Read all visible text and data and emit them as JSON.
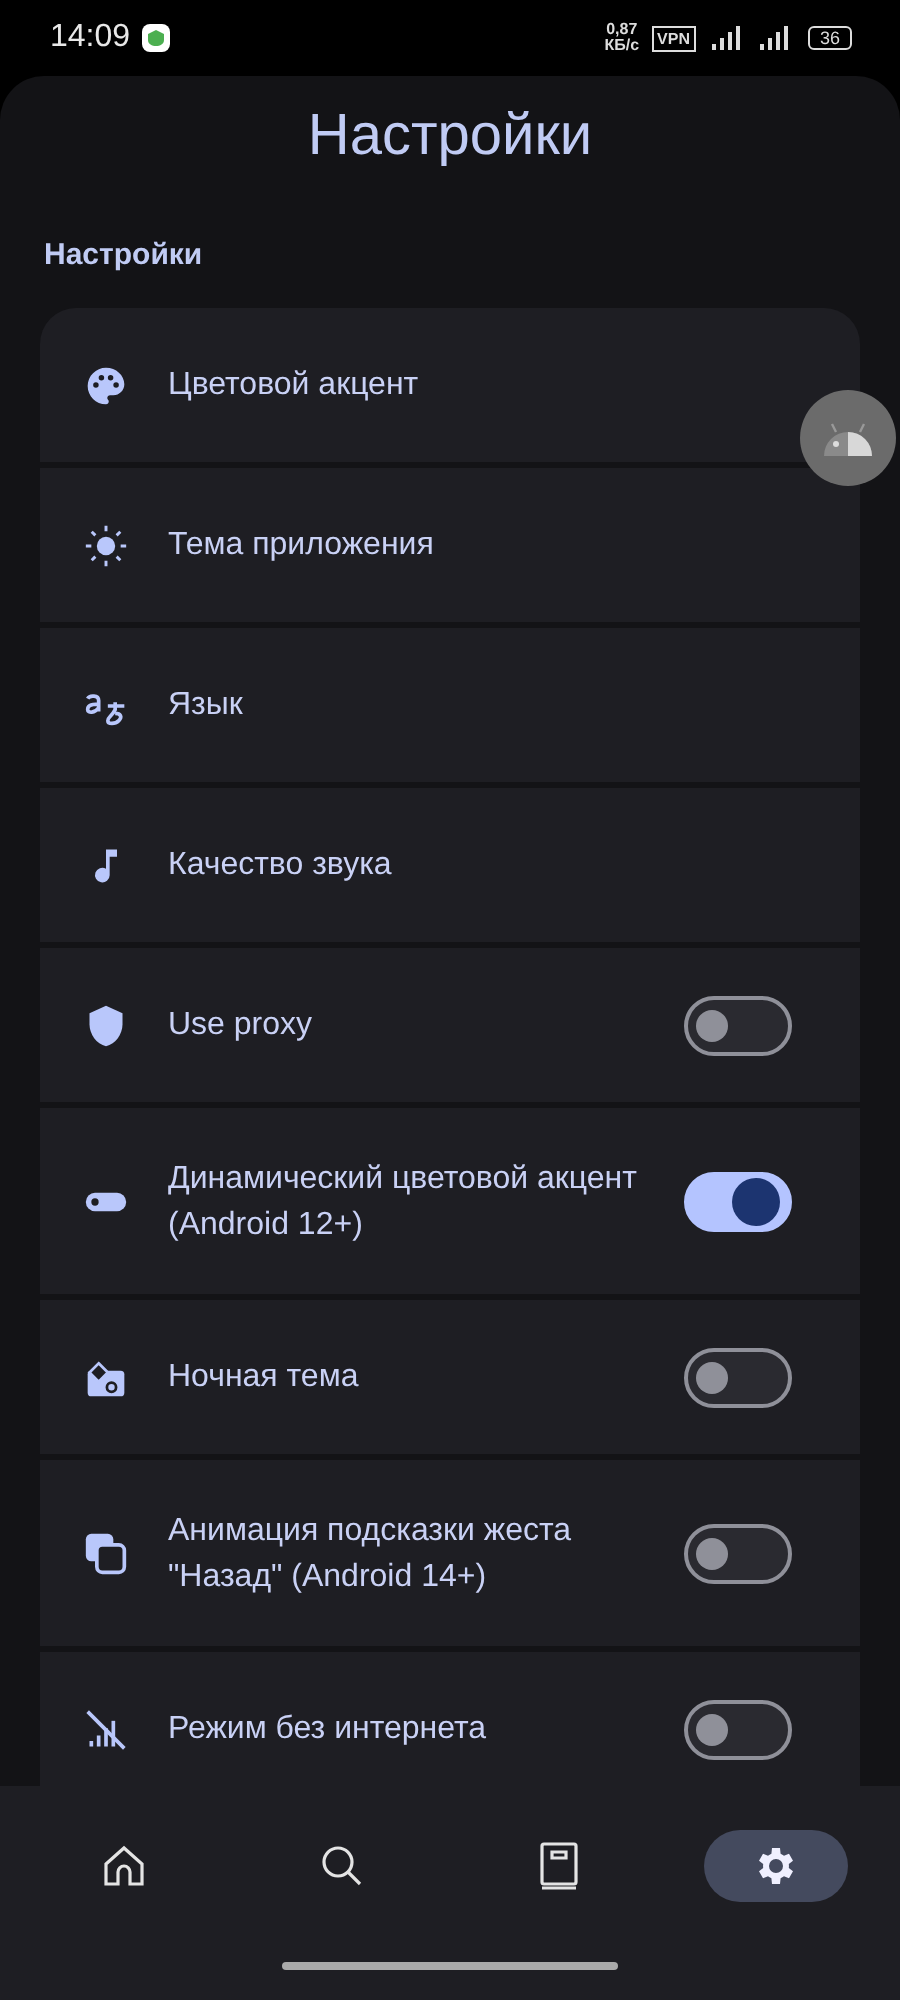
{
  "status_bar": {
    "time": "14:09",
    "speed": "0,87\nКБ/с",
    "vpn": "VPN",
    "battery": "36"
  },
  "title": "Настройки",
  "section_label": "Настройки",
  "settings": [
    {
      "kind": "link",
      "label": "Цветовой акцент"
    },
    {
      "kind": "link",
      "label": "Тема приложения"
    },
    {
      "kind": "link",
      "label": "Язык"
    },
    {
      "kind": "link",
      "label": "Качество звука"
    },
    {
      "kind": "toggle",
      "label": "Use proxy",
      "on": false
    },
    {
      "kind": "toggle",
      "label": "Динамический цветовой акцент (Android 12+)",
      "on": true
    },
    {
      "kind": "toggle",
      "label": "Ночная тема",
      "on": false
    },
    {
      "kind": "toggle",
      "label": "Анимация подсказки жеста \"Назад\" (Android 14+)",
      "on": false
    },
    {
      "kind": "toggle",
      "label": "Режим без интернета",
      "on": false
    }
  ],
  "nav": [
    {
      "selected": false
    },
    {
      "selected": false
    },
    {
      "selected": false
    },
    {
      "selected": true
    }
  ]
}
